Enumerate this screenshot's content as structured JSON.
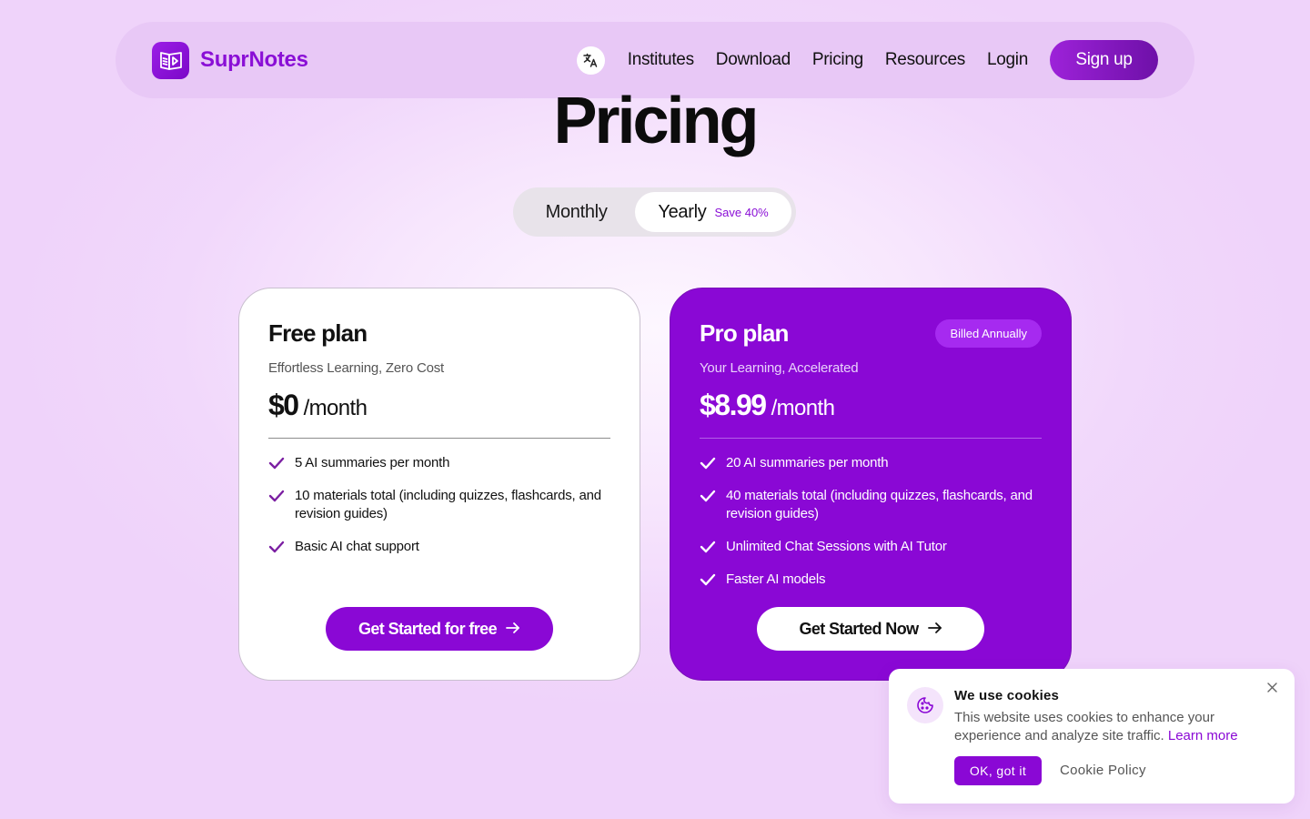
{
  "header": {
    "brand": "SuprNotes",
    "nav": [
      "Institutes",
      "Download",
      "Pricing",
      "Resources",
      "Login"
    ],
    "signup_label": "Sign up",
    "language_icon": "translate-icon"
  },
  "page": {
    "title": "Pricing"
  },
  "billing_toggle": {
    "monthly_label": "Monthly",
    "yearly_label": "Yearly",
    "yearly_badge": "Save 40%",
    "selected": "Yearly"
  },
  "plans": [
    {
      "name": "Free plan",
      "subtitle": "Effortless Learning, Zero Cost",
      "price": "$0",
      "period": "/month",
      "features": [
        "5 AI summaries per month",
        "10 materials total (including quizzes, flashcards, and revision guides)",
        "Basic AI chat support"
      ],
      "cta": "Get Started for free"
    },
    {
      "name": "Pro plan",
      "badge": "Billed Annually",
      "subtitle": "Your Learning, Accelerated",
      "price": "$8.99",
      "period": "/month",
      "features": [
        "20 AI summaries per month",
        "40 materials total (including quizzes, flashcards, and revision guides)",
        "Unlimited Chat Sessions with AI Tutor",
        "Faster AI models"
      ],
      "cta": "Get Started Now"
    }
  ],
  "cookie_banner": {
    "title": "We use cookies",
    "text": "This website uses cookies to enhance your experience and analyze site traffic.",
    "learn_more": "Learn more",
    "ok_label": "OK, got it",
    "policy_label": "Cookie Policy"
  },
  "colors": {
    "accent": "#8a08d5",
    "brand_text": "#8a0fd6",
    "header_bg": "#e8c8f6"
  }
}
